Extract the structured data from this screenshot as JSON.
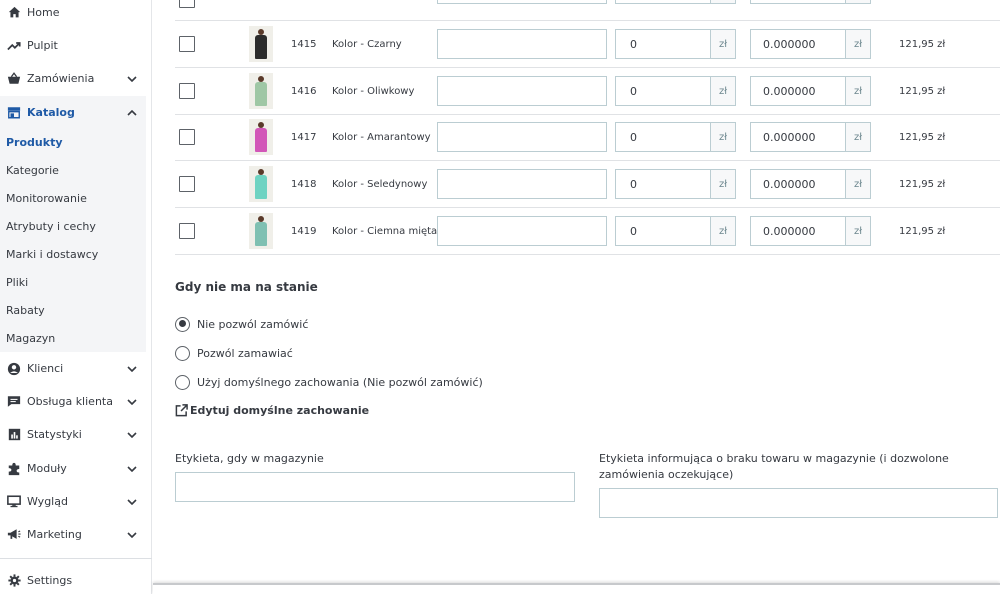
{
  "sidebar": {
    "items": [
      {
        "name": "home",
        "label": "Home",
        "icon": "home-icon"
      },
      {
        "name": "pulpit",
        "label": "Pulpit",
        "icon": "trending-up-icon"
      },
      {
        "name": "zamowienia",
        "label": "Zamówienia",
        "icon": "shopping-basket-icon"
      },
      {
        "name": "katalog",
        "label": "Katalog",
        "icon": "store-icon"
      },
      {
        "name": "klienci",
        "label": "Klienci",
        "icon": "user-circle-icon"
      },
      {
        "name": "obsluga",
        "label": "Obsługa klienta",
        "icon": "chat-icon"
      },
      {
        "name": "statystyki",
        "label": "Statystyki",
        "icon": "bar-chart-icon"
      },
      {
        "name": "moduly",
        "label": "Moduły",
        "icon": "puzzle-icon"
      },
      {
        "name": "wyglad",
        "label": "Wygląd",
        "icon": "monitor-icon"
      },
      {
        "name": "marketing",
        "label": "Marketing",
        "icon": "megaphone-icon"
      },
      {
        "name": "settings",
        "label": "Settings",
        "icon": "gear-icon"
      }
    ],
    "submenu": [
      {
        "label": "Produkty",
        "active": true
      },
      {
        "label": "Kategorie"
      },
      {
        "label": "Monitorowanie"
      },
      {
        "label": "Atrybuty i cechy"
      },
      {
        "label": "Marki i dostawcy"
      },
      {
        "label": "Pliki"
      },
      {
        "label": "Rabaty"
      },
      {
        "label": "Magazyn"
      }
    ]
  },
  "combinations": {
    "currency": "zł",
    "rows": [
      {
        "id": "1415",
        "name": "Kolor - Czarny",
        "reference": "",
        "quantity": "0",
        "impact": "0.000000",
        "price": "121,95 zł",
        "dress_color": "#2b2b2b"
      },
      {
        "id": "1416",
        "name": "Kolor - Oliwkowy",
        "reference": "",
        "quantity": "0",
        "impact": "0.000000",
        "price": "121,95 zł",
        "dress_color": "#9fc7a5"
      },
      {
        "id": "1417",
        "name": "Kolor - Amarantowy",
        "reference": "",
        "quantity": "0",
        "impact": "0.000000",
        "price": "121,95 zł",
        "dress_color": "#d257b8"
      },
      {
        "id": "1418",
        "name": "Kolor - Seledynowy",
        "reference": "",
        "quantity": "0",
        "impact": "0.000000",
        "price": "121,95 zł",
        "dress_color": "#6ed3c2"
      },
      {
        "id": "1419",
        "name": "Kolor - Ciemna mięta",
        "reference": "",
        "quantity": "0",
        "impact": "0.000000",
        "price": "121,95 zł",
        "dress_color": "#7fc0b2"
      }
    ]
  },
  "out_of_stock": {
    "title": "Gdy nie ma na stanie",
    "options": [
      {
        "label": "Nie pozwól zamówić",
        "checked": true
      },
      {
        "label": "Pozwól zamawiać",
        "checked": false
      },
      {
        "label": "Użyj domyślnego zachowania (Nie pozwól zamówić)",
        "checked": false
      }
    ],
    "edit_link": "Edytuj domyślne zachowanie",
    "in_stock_label": "Etykieta, gdy w magazynie",
    "in_stock_value": "",
    "backorder_label": "Etykieta informująca o braku towaru w magazynie (i dozwolone zamówienia oczekujące)",
    "backorder_value": ""
  }
}
